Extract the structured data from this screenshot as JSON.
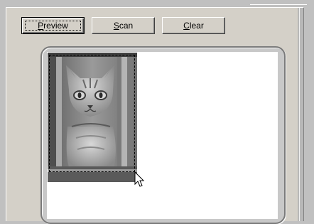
{
  "toolbar": {
    "buttons": [
      {
        "label_first": "P",
        "label_rest": "review",
        "default": true
      },
      {
        "label_first": "S",
        "label_rest": "can"
      },
      {
        "label_first": "C",
        "label_rest": "lear"
      }
    ]
  },
  "preview": {
    "image_subject": "tabby cat photo",
    "selection_marquee": true
  },
  "colors": {
    "window_bg": "#c0c0c0",
    "panel_bg": "#d4d0c8",
    "preview_bg": "#ffffff"
  },
  "icons": {
    "cursor": "arrow-pointer-icon"
  }
}
